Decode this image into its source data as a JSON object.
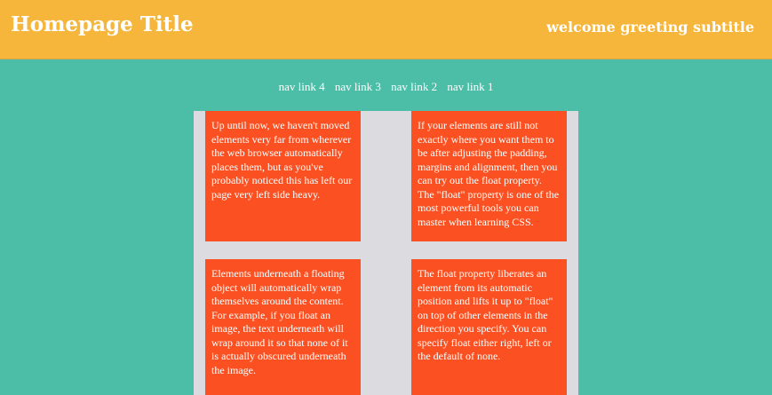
{
  "header": {
    "title": "Homepage Title",
    "subtitle": "welcome greeting subtitle"
  },
  "nav": {
    "links": [
      "nav link 4",
      "nav link 3",
      "nav link 2",
      "nav link 1"
    ]
  },
  "boxes": [
    "Up until now, we haven't moved elements very far from wherever the web browser automatically places them, but as you've probably noticed this has left our page very left side heavy.",
    "If your elements are still not exactly where you want them to be after adjusting the padding, margins and alignment, then you can try out the float property. The \"float\" property is one of the most powerful tools you can master when learning CSS.",
    "Elements underneath a floating object will automatically wrap themselves around the content. For example, if you float an image, the text underneath will wrap around it so that none of it is actually obscured underneath the image.",
    "The float property liberates an element from its automatic position and lifts it up to \"float\" on top of other elements in the direction you specify. You can specify float either right, left or the default of none."
  ],
  "colors": {
    "background": "#4cbea8",
    "header": "#f5b63b",
    "content": "#dcdbe0",
    "box": "#fb5122"
  }
}
